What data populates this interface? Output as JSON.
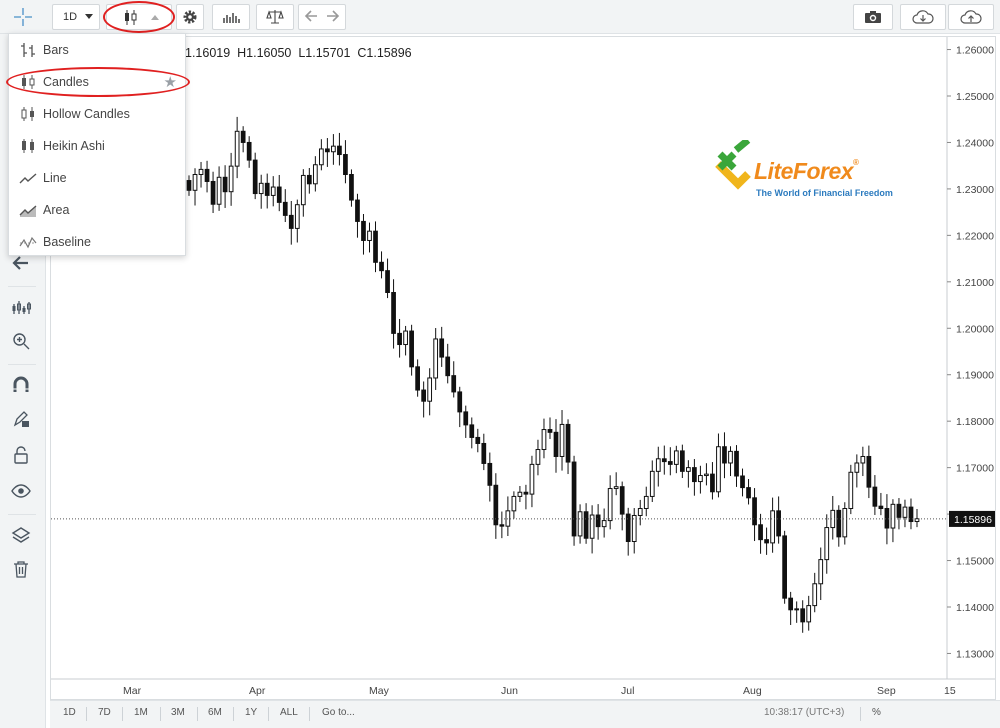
{
  "toolbar": {
    "interval": "1D",
    "buttons": [
      "interval-dropdown",
      "chart-style",
      "settings",
      "indicators",
      "compare",
      "undo",
      "redo",
      "snapshot",
      "load-chart",
      "save-chart"
    ]
  },
  "chart_style_menu": {
    "items": [
      {
        "label": "Bars",
        "icon": "bars-icon"
      },
      {
        "label": "Candles",
        "icon": "candles-icon",
        "selected": true,
        "starred": true
      },
      {
        "label": "Hollow Candles",
        "icon": "hollow-candles-icon"
      },
      {
        "label": "Heikin Ashi",
        "icon": "heikin-ashi-icon"
      },
      {
        "label": "Line",
        "icon": "line-icon"
      },
      {
        "label": "Area",
        "icon": "area-icon"
      },
      {
        "label": "Baseline",
        "icon": "baseline-icon"
      }
    ]
  },
  "ohlc_legend": {
    "open_partial": "1.16019",
    "high": "H1.16050",
    "low": "L1.15701",
    "close": "C1.15896"
  },
  "logo": {
    "text": "LiteForex",
    "reg": "®",
    "tagline": "The World of Financial Freedom"
  },
  "bottom_bar": {
    "ranges": [
      "1D",
      "7D",
      "1M",
      "3M",
      "6M",
      "1Y",
      "ALL"
    ],
    "goto": "Go to...",
    "clock": "10:38:17 (UTC+3)",
    "percent": "%"
  },
  "colors": {
    "candle": "#111111",
    "price_label_bg": "#111111",
    "highlight": "#e02020",
    "logo_orange": "#f08a1c",
    "logo_green": "#3aa63a",
    "logo_blue": "#2c7bbf"
  },
  "chart_data": {
    "type": "candlestick",
    "title": "",
    "xlabel": "",
    "ylabel": "",
    "ylim": [
      1.1245,
      1.2627
    ],
    "y_ticks": [
      "1.26000",
      "1.25000",
      "1.24000",
      "1.23000",
      "1.22000",
      "1.21000",
      "1.20000",
      "1.19000",
      "1.18000",
      "1.17000",
      "1.16000",
      "1.15000",
      "1.14000",
      "1.13000"
    ],
    "x_tick_labels": [
      "Mar",
      "Apr",
      "May",
      "Jun",
      "Jul",
      "Aug",
      "Sep",
      "15"
    ],
    "last_price": "1.15896",
    "series_close": [
      1.2297,
      1.2331,
      1.2342,
      1.2316,
      1.2267,
      1.2325,
      1.2294,
      1.2349,
      1.2424,
      1.24,
      1.2362,
      1.229,
      1.2312,
      1.2286,
      1.2304,
      1.2271,
      1.2243,
      1.2215,
      1.2266,
      1.2329,
      1.2311,
      1.2352,
      1.2386,
      1.238,
      1.2392,
      1.2374,
      1.2331,
      1.2276,
      1.223,
      1.2189,
      1.2209,
      1.2142,
      1.2124,
      1.2077,
      1.1989,
      1.1965,
      1.1994,
      1.1917,
      1.1867,
      1.1843,
      1.1893,
      1.1977,
      1.1938,
      1.1898,
      1.1863,
      1.182,
      1.1792,
      1.1765,
      1.1752,
      1.1709,
      1.1662,
      1.1577,
      1.1574,
      1.1607,
      1.1638,
      1.1647,
      1.1643,
      1.1707,
      1.1739,
      1.1782,
      1.1776,
      1.1724,
      1.1793,
      1.1712,
      1.1553,
      1.1605,
      1.1548,
      1.1598,
      1.1573,
      1.1586,
      1.1655,
      1.1659,
      1.16,
      1.1541,
      1.1597,
      1.1612,
      1.1638,
      1.1692,
      1.1719,
      1.1713,
      1.1707,
      1.1736,
      1.1692,
      1.17,
      1.167,
      1.1683,
      1.1686,
      1.1648,
      1.1745,
      1.171,
      1.1735,
      1.1682,
      1.1657,
      1.1635,
      1.1577,
      1.1545,
      1.1538,
      1.1607,
      1.1553,
      1.1419,
      1.1394,
      1.1396,
      1.1368,
      1.1403,
      1.145,
      1.1502,
      1.1571,
      1.1608,
      1.1551,
      1.1612,
      1.169,
      1.171,
      1.1724,
      1.1658,
      1.1617,
      1.1612,
      1.157,
      1.1621,
      1.1593,
      1.1615,
      1.1584,
      1.159
    ]
  }
}
